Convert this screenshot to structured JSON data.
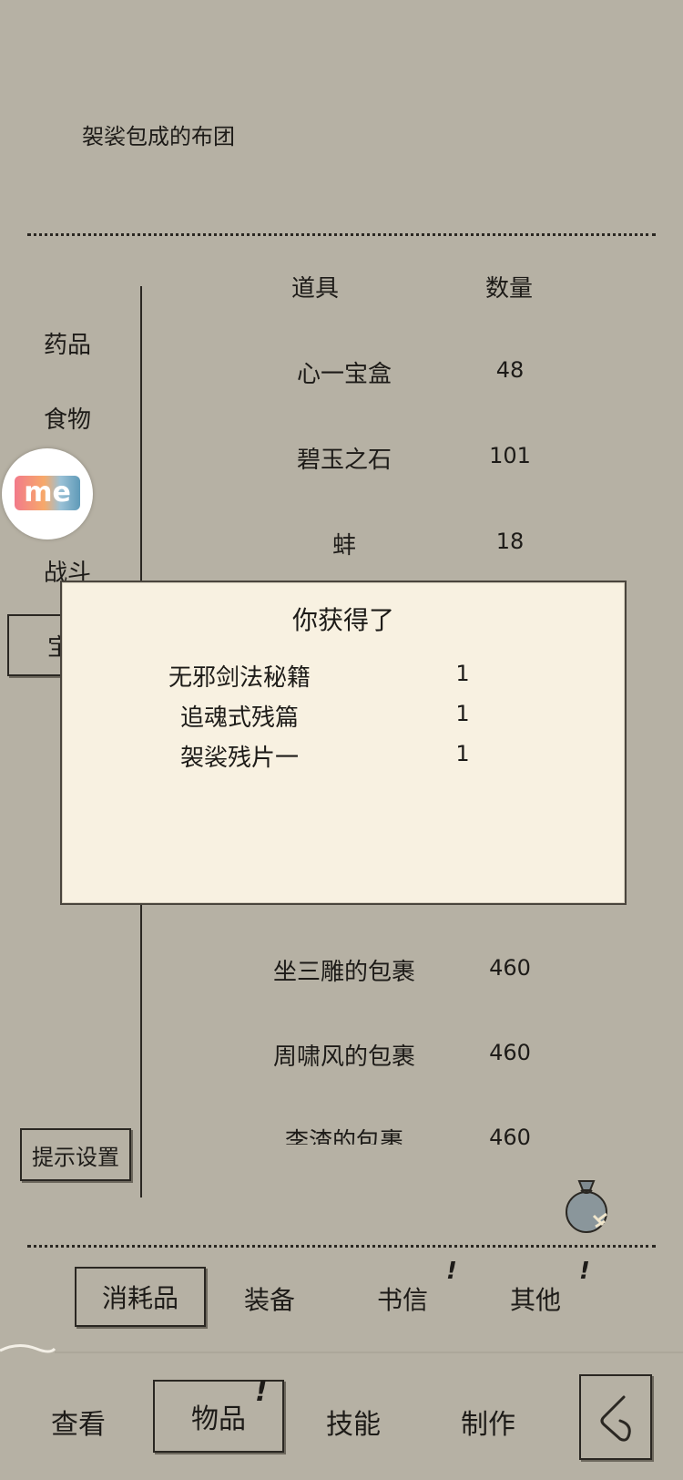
{
  "description": "袈裟包成的布团",
  "categories": [
    "药品",
    "食物",
    "战斗",
    "宝"
  ],
  "table": {
    "header_item": "道具",
    "header_qty": "数量",
    "rows_top": [
      {
        "name": "心一宝盒",
        "qty": "48"
      },
      {
        "name": "碧玉之石",
        "qty": "101"
      },
      {
        "name": "蚌",
        "qty": "18"
      }
    ],
    "rows_bottom": [
      {
        "name": "坐三雕的包裹",
        "qty": "460"
      },
      {
        "name": "周啸风的包裹",
        "qty": "460"
      },
      {
        "name": "李渣的包裹",
        "qty": "460"
      }
    ]
  },
  "hint_settings_label": "提示设置",
  "popup": {
    "title": "你获得了",
    "items": [
      {
        "name": "无邪剑法秘籍",
        "qty": "1"
      },
      {
        "name": "追魂式残篇",
        "qty": "1"
      },
      {
        "name": "袈裟残片一",
        "qty": "1"
      }
    ]
  },
  "overlay_badge": "me",
  "subtabs": [
    "消耗品",
    "装备",
    "书信",
    "其他"
  ],
  "subtab_marks": [
    "!",
    "!"
  ],
  "bottom_nav": [
    "查看",
    "物品",
    "技能",
    "制作"
  ],
  "bottom_nav_mark": "!",
  "icons": {
    "bag": "money-bag-icon",
    "back": "back-arrow-icon"
  }
}
